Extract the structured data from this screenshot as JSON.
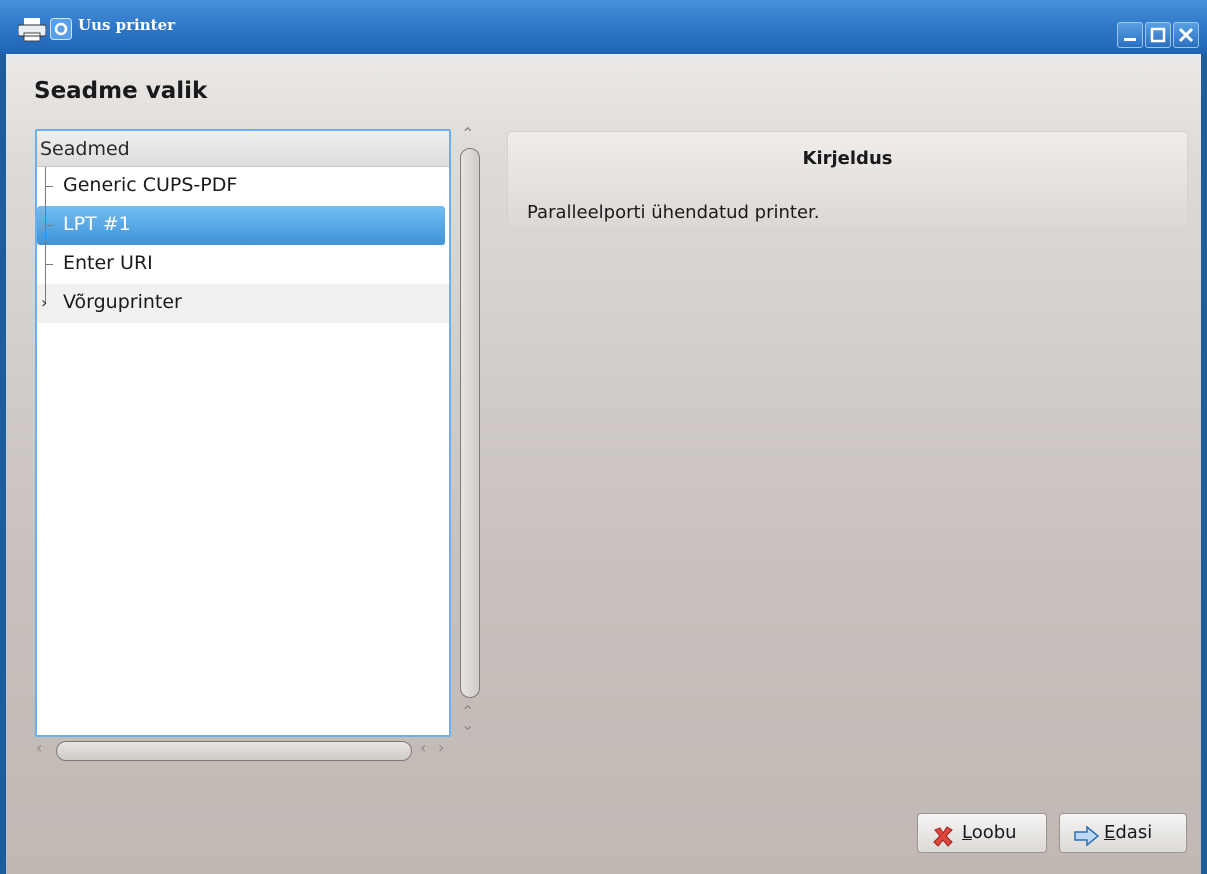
{
  "window": {
    "title": "Uus printer",
    "controls": [
      "minimize",
      "maximize",
      "close"
    ]
  },
  "main": {
    "heading": "Seadme valik",
    "tree": {
      "header": "Seadmed",
      "items": [
        {
          "label": "Generic CUPS-PDF",
          "selected": false
        },
        {
          "label": "LPT #1",
          "selected": true
        },
        {
          "label": "Enter URI",
          "selected": false
        },
        {
          "label": "Võrguprinter",
          "selected": false,
          "expandable": true
        }
      ]
    },
    "description": {
      "title": "Kirjeldus",
      "text": "Paralleelporti ühendatud printer."
    }
  },
  "buttons": {
    "cancel": {
      "mnemonic": "L",
      "rest": "oobu",
      "icon": "cancel-x-icon"
    },
    "next": {
      "mnemonic": "E",
      "rest": "dasi",
      "icon": "forward-arrow-icon"
    }
  },
  "colors": {
    "titlebar": "#2f78c9",
    "selection": "#4a9be0",
    "tree_border": "#6ab0f0"
  }
}
